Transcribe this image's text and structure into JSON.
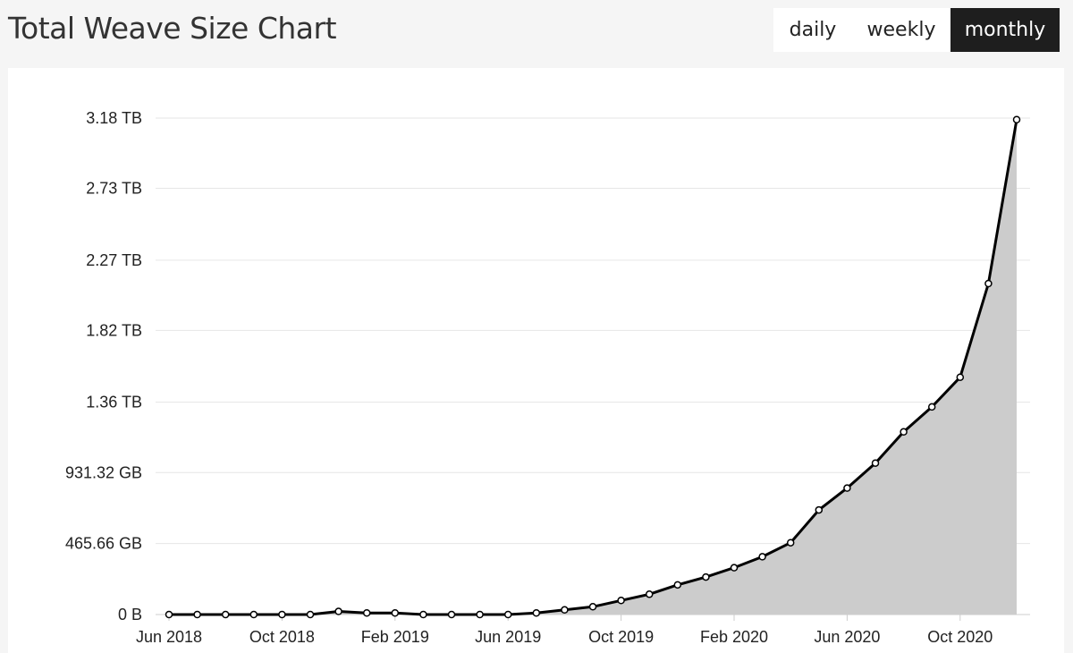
{
  "header": {
    "title": "Total Weave Size Chart"
  },
  "period_toggle": {
    "options": [
      "daily",
      "weekly",
      "monthly"
    ],
    "selected": "monthly"
  },
  "colors": {
    "line": "#000000",
    "area_fill": "#cccccc",
    "gridline": "#e6e6e6",
    "active_button": "#1e1e1e"
  },
  "chart_data": {
    "type": "area",
    "title": "Total Weave Size Chart",
    "xlabel": "",
    "ylabel": "",
    "y_unit": "TB",
    "ylim": [
      0,
      3.18
    ],
    "yticks": [
      {
        "value": 0,
        "label": "0 B"
      },
      {
        "value": 0.4548,
        "label": "465.66 GB"
      },
      {
        "value": 0.9095,
        "label": "931.32 GB"
      },
      {
        "value": 1.36,
        "label": "1.36 TB"
      },
      {
        "value": 1.82,
        "label": "1.82 TB"
      },
      {
        "value": 2.27,
        "label": "2.27 TB"
      },
      {
        "value": 2.73,
        "label": "2.73 TB"
      },
      {
        "value": 3.18,
        "label": "3.18 TB"
      }
    ],
    "xticks": [
      {
        "value": "2018-06",
        "label": "Jun 2018"
      },
      {
        "value": "2018-10",
        "label": "Oct 2018"
      },
      {
        "value": "2019-02",
        "label": "Feb 2019"
      },
      {
        "value": "2019-06",
        "label": "Jun 2019"
      },
      {
        "value": "2019-10",
        "label": "Oct 2019"
      },
      {
        "value": "2020-02",
        "label": "Feb 2020"
      },
      {
        "value": "2020-06",
        "label": "Jun 2020"
      },
      {
        "value": "2020-10",
        "label": "Oct 2020"
      }
    ],
    "x": [
      "2018-06",
      "2018-07",
      "2018-08",
      "2018-09",
      "2018-10",
      "2018-11",
      "2018-12",
      "2019-01",
      "2019-02",
      "2019-03",
      "2019-04",
      "2019-05",
      "2019-06",
      "2019-07",
      "2019-08",
      "2019-09",
      "2019-10",
      "2019-11",
      "2019-12",
      "2020-01",
      "2020-02",
      "2020-03",
      "2020-04",
      "2020-05",
      "2020-06",
      "2020-07",
      "2020-08",
      "2020-09",
      "2020-10",
      "2020-11",
      "2020-12"
    ],
    "values": [
      0.0,
      0.0,
      0.0,
      0.0,
      0.0,
      0.0,
      0.02,
      0.01,
      0.01,
      0.0,
      0.0,
      0.0,
      0.0,
      0.01,
      0.03,
      0.05,
      0.09,
      0.13,
      0.19,
      0.24,
      0.3,
      0.37,
      0.46,
      0.67,
      0.81,
      0.97,
      1.17,
      1.33,
      1.52,
      2.12,
      3.17
    ],
    "grid": true,
    "legend": "none"
  }
}
